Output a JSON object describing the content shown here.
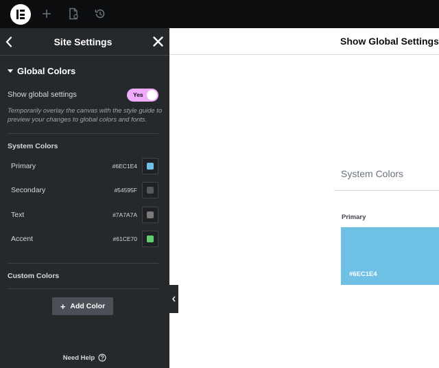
{
  "panel": {
    "title": "Site Settings",
    "section_title": "Global Colors",
    "toggle": {
      "label": "Show global settings",
      "state_text": "Yes",
      "color": "#f0abfc"
    },
    "description": "Temporarily overlay the canvas with the style guide to preview your changes to global colors and fonts.",
    "system_colors_heading": "System Colors",
    "system_colors": [
      {
        "name": "Primary",
        "hex": "#6EC1E4",
        "color": "#6ec1e4"
      },
      {
        "name": "Secondary",
        "hex": "#54595F",
        "color": "#54595f"
      },
      {
        "name": "Text",
        "hex": "#7A7A7A",
        "color": "#7a7a7a"
      },
      {
        "name": "Accent",
        "hex": "#61CE70",
        "color": "#61ce70"
      }
    ],
    "custom_colors_heading": "Custom Colors",
    "add_color_label": "Add Color",
    "need_help_label": "Need Help"
  },
  "canvas": {
    "header_title": "Show Global Settings",
    "section_title": "System Colors",
    "card": {
      "label": "Primary",
      "hex": "#6EC1E4",
      "color": "#6ec1e4"
    }
  },
  "theme": {
    "topbar_bg": "#0c0d0e",
    "panel_bg": "#26292c"
  }
}
